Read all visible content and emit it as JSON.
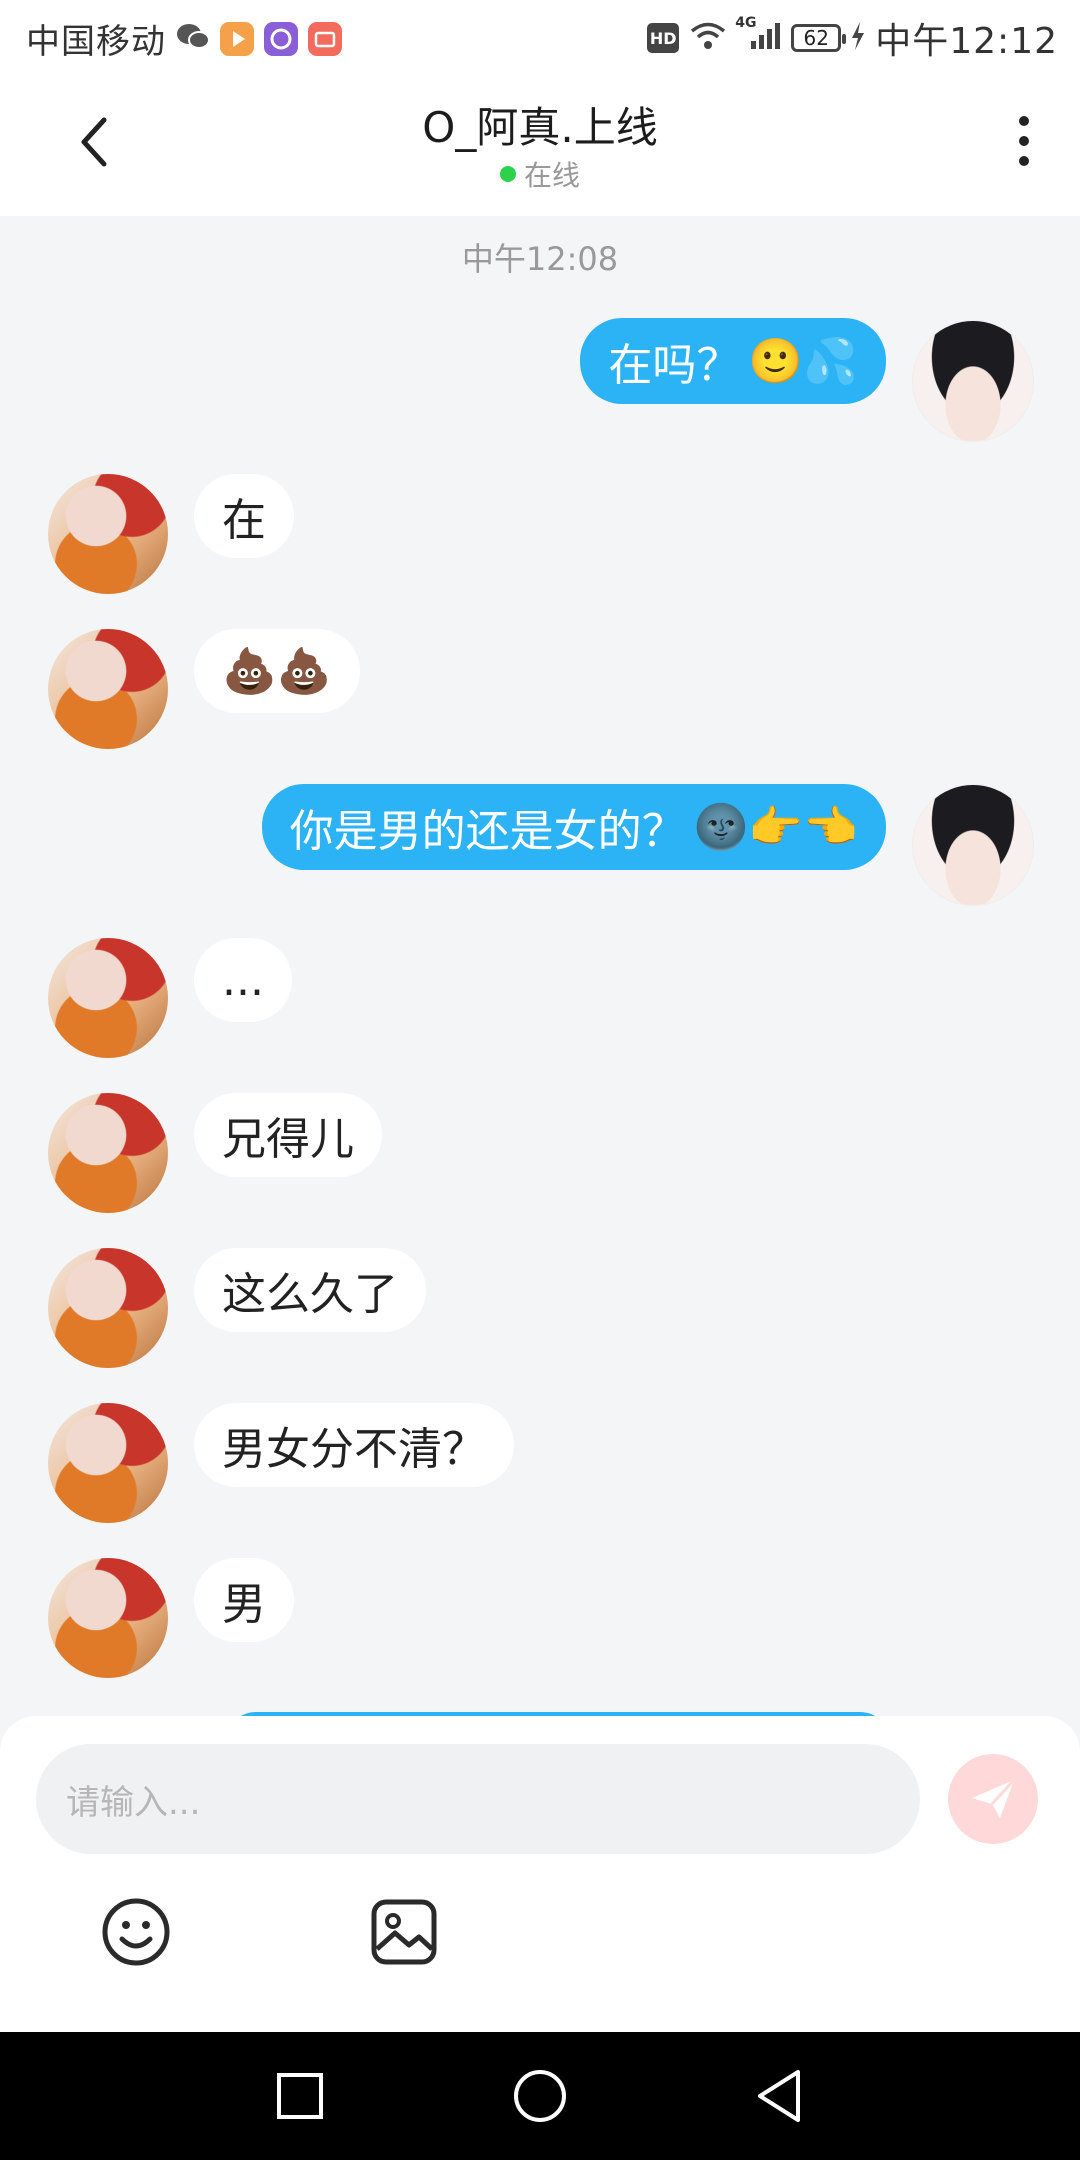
{
  "status_bar": {
    "carrier": "中国移动",
    "time": "中午12:12",
    "battery": "62",
    "network": "4G",
    "hd_label": "HD"
  },
  "header": {
    "title": "O_阿真.上线",
    "status": "在线"
  },
  "chat": {
    "time_separator": "中午12:08",
    "messages": [
      {
        "side": "out",
        "text": "在吗？",
        "emoji": "🙂💦"
      },
      {
        "side": "in",
        "text": "在",
        "emoji": ""
      },
      {
        "side": "in",
        "text": "",
        "emoji": "💩💩"
      },
      {
        "side": "out",
        "text": "你是男的还是女的？",
        "emoji": "🌚👉👈"
      },
      {
        "side": "in",
        "text": "...",
        "emoji": ""
      },
      {
        "side": "in",
        "text": "兄得儿",
        "emoji": ""
      },
      {
        "side": "in",
        "text": "这么久了",
        "emoji": ""
      },
      {
        "side": "in",
        "text": "男女分不清？",
        "emoji": ""
      },
      {
        "side": "in",
        "text": "男",
        "emoji": ""
      }
    ]
  },
  "composer": {
    "placeholder": "请输入..."
  },
  "icons": {
    "back": "back-arrow-icon",
    "more": "more-vertical-icon",
    "send": "send-icon",
    "emoji": "emoji-icon",
    "image": "image-icon"
  },
  "colors": {
    "outgoing_bubble": "#2bb3f5",
    "online": "#2bd24a",
    "send_button": "#ffd9d9"
  }
}
